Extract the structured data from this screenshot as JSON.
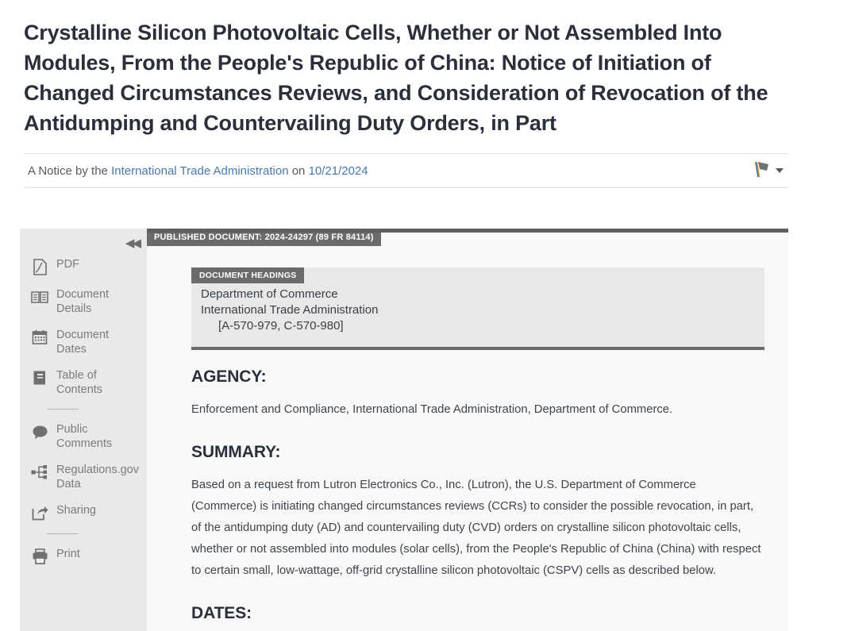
{
  "header": {
    "title": "Crystalline Silicon Photovoltaic Cells, Whether or Not Assembled Into Modules, From the People's Republic of China: Notice of Initiation of Changed Circumstances Reviews, and Consideration of Revocation of the Antidumping and Countervailing Duty Orders, in Part",
    "byline_prefix": "A Notice by the",
    "agency_link": "International Trade Administration",
    "byline_mid": "on",
    "date": "10/21/2024",
    "flag_icon": "flag-icon",
    "caret_icon": "chevron-down-icon"
  },
  "sidebar": {
    "collapse_label": "◀◀",
    "items": [
      {
        "label": "PDF",
        "icon": "pdf-page-icon"
      },
      {
        "label": "Document Details",
        "icon": "open-book-icon"
      },
      {
        "label": "Document Dates",
        "icon": "calendar-icon"
      },
      {
        "label": "Table of Contents",
        "icon": "book-icon"
      },
      {
        "label": "Public Comments",
        "icon": "speech-bubble-icon"
      },
      {
        "label": "Regulations.gov Data",
        "icon": "sitemap-icon"
      },
      {
        "label": "Sharing",
        "icon": "share-icon"
      },
      {
        "label": "Print",
        "icon": "printer-icon"
      }
    ]
  },
  "content": {
    "published_tab": "PUBLISHED DOCUMENT: 2024-24297 (89 FR 84114)",
    "headings_tab": "DOCUMENT HEADINGS",
    "headings": [
      "Department of Commerce",
      "International Trade Administration",
      "[A-570-979, C-570-980]"
    ],
    "agency_heading": "AGENCY:",
    "agency_body": "Enforcement and Compliance, International Trade Administration, Department of Commerce.",
    "summary_heading": "SUMMARY:",
    "summary_body": "Based on a request from Lutron Electronics Co., Inc. (Lutron), the U.S. Department of Commerce (Commerce) is initiating changed circumstances reviews (CCRs) to consider the possible revocation, in part, of the antidumping duty (AD) and countervailing duty (CVD) orders on crystalline silicon photovoltaic cells, whether or not assembled into modules (solar cells), from the People's Republic of China (China) with respect to certain small, low-wattage, off-grid crystalline silicon photovoltaic (CSPV) cells as described below.",
    "dates_heading": "DATES:"
  }
}
